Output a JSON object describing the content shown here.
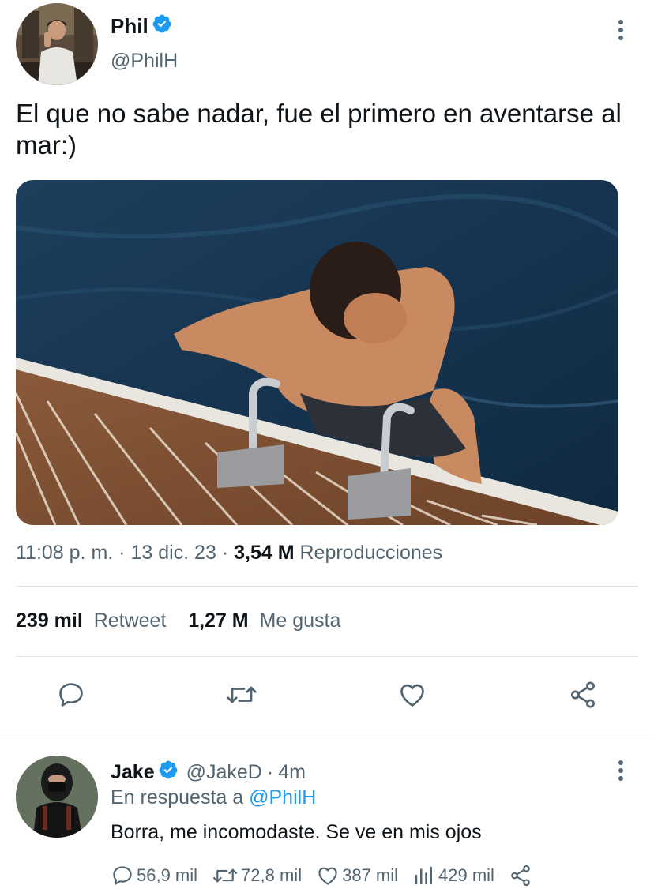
{
  "tweet": {
    "author_name": "Phil",
    "author_handle": "@PhilH",
    "text": "El que no sabe nadar, fue el primero en aventarse al mar:)",
    "meta": {
      "time": "11:08 p. m.",
      "sep1": "·",
      "date": "13 dic. 23",
      "sep2": "·",
      "views_count": "3,54 M",
      "views_label": "Reproducciones"
    },
    "stats": {
      "retweets_count": "239 mil",
      "retweets_label": "Retweet",
      "likes_count": "1,27 M",
      "likes_label": "Me gusta"
    }
  },
  "reply": {
    "author_name": "Jake",
    "author_handle": "@JakeD",
    "time_sep": "·",
    "time": "4m",
    "replying_to_label": "En respuesta a",
    "replying_to_handle": "@PhilH",
    "text": "Borra, me incomodaste. Se ve en mis ojos",
    "actions": {
      "replies": "56,9 mil",
      "retweets": "72,8 mil",
      "likes": "387 mil",
      "views": "429 mil"
    }
  },
  "icons": {
    "verified": "verified-badge-icon",
    "more": "more-vertical-icon",
    "reply": "reply-bubble-icon",
    "retweet": "retweet-icon",
    "like": "heart-icon",
    "share": "share-icon",
    "views": "views-bars-icon"
  },
  "colors": {
    "verified_blue": "#1d9bf0",
    "secondary_text": "#536471",
    "primary_text": "#0f1419",
    "link": "#1d9bf0"
  }
}
